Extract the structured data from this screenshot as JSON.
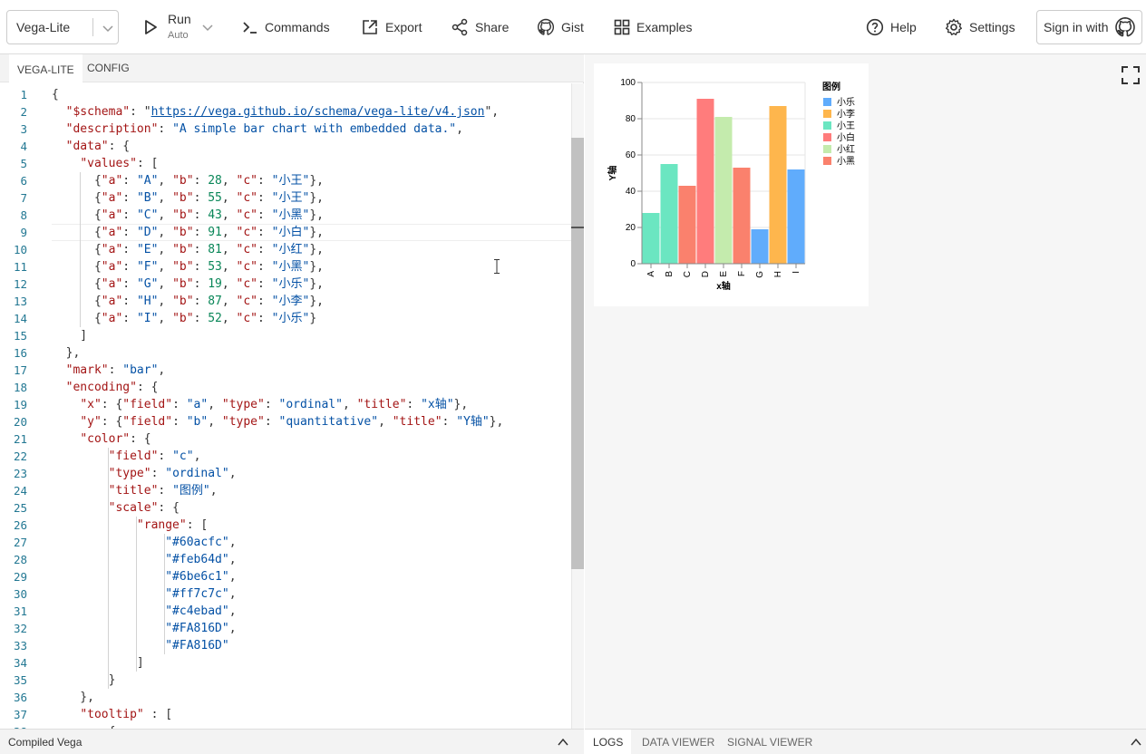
{
  "header": {
    "mode": "Vega-Lite",
    "run_label": "Run",
    "run_sub": "Auto",
    "commands": "Commands",
    "export": "Export",
    "share": "Share",
    "gist": "Gist",
    "examples": "Examples",
    "help": "Help",
    "settings": "Settings",
    "signin": "Sign in with"
  },
  "editor": {
    "tabs": [
      "VEGA-LITE",
      "CONFIG"
    ],
    "active_tab": "VEGA-LITE",
    "lines": [
      "{",
      "  \"$schema\": \"https://vega.github.io/schema/vega-lite/v4.json\",",
      "  \"description\": \"A simple bar chart with embedded data.\",",
      "  \"data\": {",
      "    \"values\": [",
      "      {\"a\": \"A\", \"b\": 28, \"c\": \"小王\"},",
      "      {\"a\": \"B\", \"b\": 55, \"c\": \"小王\"},",
      "      {\"a\": \"C\", \"b\": 43, \"c\": \"小黑\"},",
      "      {\"a\": \"D\", \"b\": 91, \"c\": \"小白\"},",
      "      {\"a\": \"E\", \"b\": 81, \"c\": \"小红\"},",
      "      {\"a\": \"F\", \"b\": 53, \"c\": \"小黑\"},",
      "      {\"a\": \"G\", \"b\": 19, \"c\": \"小乐\"},",
      "      {\"a\": \"H\", \"b\": 87, \"c\": \"小李\"},",
      "      {\"a\": \"I\", \"b\": 52, \"c\": \"小乐\"}",
      "    ]",
      "  },",
      "  \"mark\": \"bar\",",
      "  \"encoding\": {",
      "    \"x\": {\"field\": \"a\", \"type\": \"ordinal\", \"title\": \"x轴\"},",
      "    \"y\": {\"field\": \"b\", \"type\": \"quantitative\", \"title\": \"Y轴\"},",
      "    \"color\": {",
      "        \"field\": \"c\",",
      "        \"type\": \"ordinal\",",
      "        \"title\": \"图例\",",
      "        \"scale\": {",
      "            \"range\": [",
      "                \"#60acfc\",",
      "                \"#feb64d\",",
      "                \"#6be6c1\",",
      "                \"#ff7c7c\",",
      "                \"#c4ebad\",",
      "                \"#FA816D\",",
      "                \"#FA816D\"",
      "            ]",
      "        }",
      "    },",
      "    \"tooltip\" : [",
      "        {"
    ],
    "current_line": 9
  },
  "compiled_label": "Compiled Vega",
  "log_tabs": [
    "LOGS",
    "DATA VIEWER",
    "SIGNAL VIEWER"
  ],
  "chart_data": {
    "type": "bar",
    "categories": [
      "A",
      "B",
      "C",
      "D",
      "E",
      "F",
      "G",
      "H",
      "I"
    ],
    "values": [
      28,
      55,
      43,
      91,
      81,
      53,
      19,
      87,
      52
    ],
    "groups": [
      "小王",
      "小王",
      "小黑",
      "小白",
      "小红",
      "小黑",
      "小乐",
      "小李",
      "小乐"
    ],
    "bar_colors": [
      "#6be6c1",
      "#6be6c1",
      "#FA816D",
      "#ff7c7c",
      "#c4ebad",
      "#FA816D",
      "#60acfc",
      "#feb64d",
      "#60acfc"
    ],
    "xlabel": "x轴",
    "ylabel": "Y轴",
    "ylim": [
      0,
      100
    ],
    "yticks": [
      0,
      20,
      40,
      60,
      80,
      100
    ],
    "grid": true,
    "legend": {
      "title": "图例",
      "position": "right",
      "items": [
        {
          "label": "小乐",
          "color": "#60acfc"
        },
        {
          "label": "小李",
          "color": "#feb64d"
        },
        {
          "label": "小王",
          "color": "#6be6c1"
        },
        {
          "label": "小白",
          "color": "#ff7c7c"
        },
        {
          "label": "小红",
          "color": "#c4ebad"
        },
        {
          "label": "小黑",
          "color": "#FA816D"
        }
      ]
    }
  }
}
